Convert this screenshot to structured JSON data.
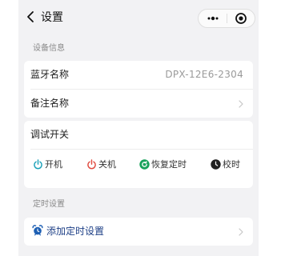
{
  "nav": {
    "title": "设置",
    "back_icon": "chevron-left-icon",
    "more_icon": "more-dots-icon",
    "close_icon": "target-close-icon"
  },
  "device_info": {
    "section_title": "设备信息",
    "bluetooth_label": "蓝牙名称",
    "bluetooth_value": "DPX-12E6-2304",
    "remark_label": "备注名称"
  },
  "debug": {
    "title": "调试开关",
    "controls": [
      {
        "label": "开机",
        "icon": "power-icon",
        "color": "#1aa0b8"
      },
      {
        "label": "关机",
        "icon": "power-icon",
        "color": "#e04a3f"
      },
      {
        "label": "恢复定时",
        "icon": "refresh-icon",
        "color": "#19a25b"
      },
      {
        "label": "校时",
        "icon": "clock-icon",
        "color": "#222222"
      }
    ]
  },
  "timer": {
    "section_title": "定时设置",
    "add_label": "添加定时设置",
    "add_icon": "alarm-clock-icon"
  },
  "colors": {
    "background": "#f2f2f4",
    "card": "#ffffff",
    "link": "#1d3f86",
    "muted": "#9a9a9a"
  }
}
